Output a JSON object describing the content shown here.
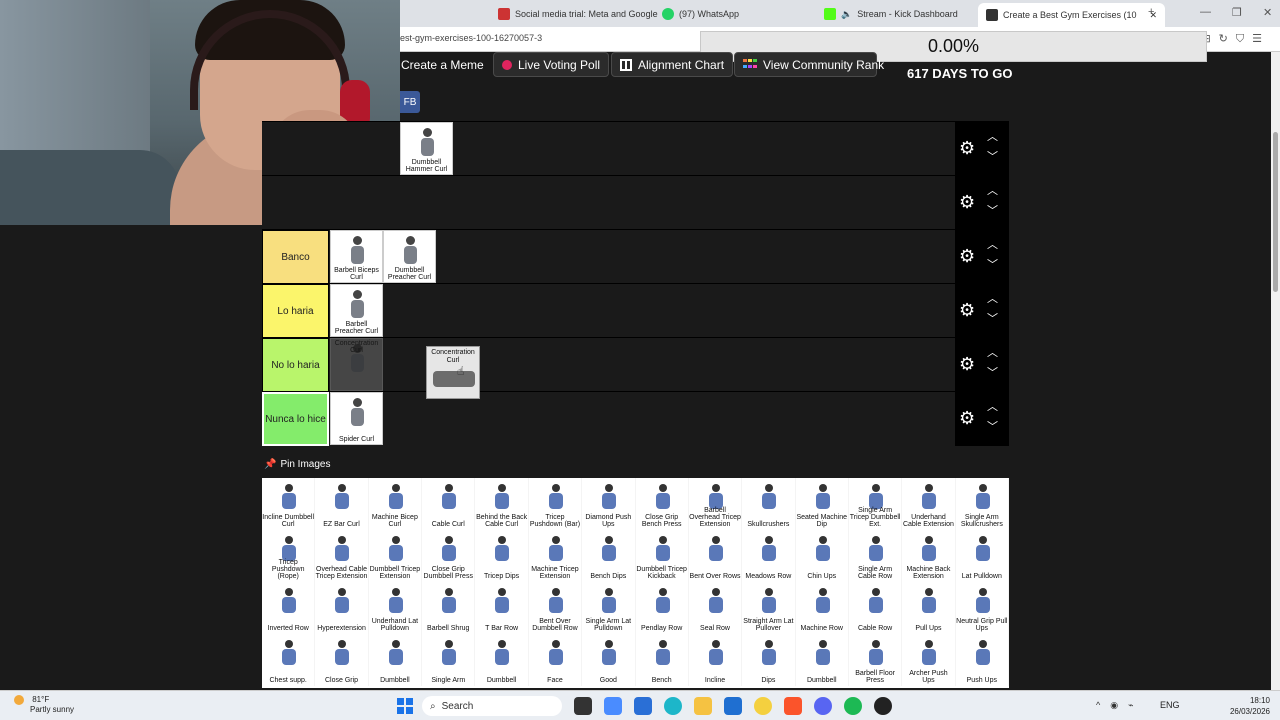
{
  "browser": {
    "tabs": [
      {
        "label": "Social media trial: Meta and Google",
        "color": "#c33"
      },
      {
        "label": "(97) WhatsApp",
        "color": "#25d366"
      },
      {
        "label": "Stream - Kick Dashboard",
        "color": "#53fc18"
      },
      {
        "label": "Create a Best Gym Exercises (10",
        "color": "#333"
      }
    ],
    "url": "est-gym-exercises-100-16270057-3",
    "progress_text": "0.00%"
  },
  "toolbar": {
    "create_meme": "Create a Meme",
    "live_poll": "Live Voting Poll",
    "alignment_chart": "Alignment Chart",
    "community_rank": "View Community Rank",
    "days_to_go": "617 DAYS TO GO",
    "fb": "FB"
  },
  "tiers": [
    {
      "label": "",
      "color": "#1a1a1a",
      "items": [
        {
          "caption": "Dumbbell Hammer Curl"
        }
      ]
    },
    {
      "label": "",
      "color": "#1a1a1a",
      "items": []
    },
    {
      "label": "Banco",
      "color": "#f8df7f",
      "items": [
        {
          "caption": "Barbell Biceps Curl"
        },
        {
          "caption": "Dumbbell Preacher Curl"
        }
      ]
    },
    {
      "label": "Lo haria",
      "color": "#fbf56b",
      "items": [
        {
          "caption": "Barbell Preacher Curl"
        }
      ]
    },
    {
      "label": "No lo haria",
      "color": "#b9f56b",
      "items": [
        {
          "caption": "Concentration Curl",
          "faded": true
        }
      ]
    },
    {
      "label": "Nunca lo hice",
      "color": "#84ec6b",
      "items": [
        {
          "caption": "Spider Curl"
        }
      ]
    }
  ],
  "dragging_item": {
    "caption": "Concentration Curl"
  },
  "pin_images": {
    "label": "Pin Images",
    "items": [
      "Incline Dumbbell Curl",
      "EZ Bar Curl",
      "Machine Bicep Curl",
      "Cable Curl",
      "Behind the Back Cable Curl",
      "Tricep Pushdown (Bar)",
      "Diamond Push Ups",
      "Close Grip Bench Press",
      "Barbell Overhead Tricep Extension",
      "Skullcrushers",
      "Seated Machine Dip",
      "Single Arm Tricep Dumbbell Ext.",
      "Underhand Cable Extension",
      "Single Arm Skullcrushers",
      "Tricep Pushdown (Rope)",
      "Overhead Cable Tricep Extension",
      "Dumbbell Tricep Extension",
      "Close Grip Dumbbell Press",
      "Tricep Dips",
      "Machine Tricep Extension",
      "Bench Dips",
      "Dumbbell Tricep Kickback",
      "Bent Over Rows",
      "Meadows Row",
      "Chin Ups",
      "Single Arm Cable Row",
      "Machine Back Extension",
      "Lat Pulldown",
      "Inverted Row",
      "Hyperextension",
      "Underhand Lat Pulldown",
      "Barbell Shrug",
      "T Bar Row",
      "Bent Over Dumbbell Row",
      "Single Arm Lat Pulldown",
      "Pendlay Row",
      "Seal Row",
      "Straight Arm Lat Pullover",
      "Machine Row",
      "Cable Row",
      "Pull Ups",
      "Neutral Grip Pull Ups",
      "Chest supp.",
      "Close Grip",
      "Dumbbell",
      "Single Arm",
      "Dumbbell",
      "Face",
      "Good",
      "Bench",
      "Incline",
      "Dips",
      "Dumbbell",
      "Barbell Floor Press",
      "Archer Push Ups",
      "Push Ups"
    ]
  },
  "taskbar": {
    "temp": "81°F",
    "weather": "Partly sunny",
    "search": "Search",
    "lang": "ENG",
    "time": "18:10",
    "date": "26/03/2026"
  }
}
